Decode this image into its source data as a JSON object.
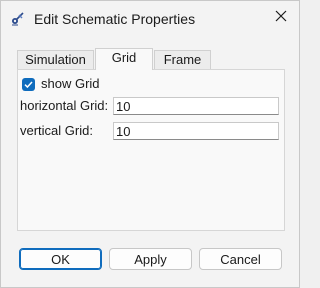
{
  "window": {
    "title": "Edit Schematic Properties",
    "app_icon": "schematic-app-icon",
    "close_icon": "close-icon"
  },
  "tabs": [
    {
      "label": "Simulation",
      "active": false
    },
    {
      "label": "Grid",
      "active": true
    },
    {
      "label": "Frame",
      "active": false
    }
  ],
  "grid": {
    "show_grid_label": "show Grid",
    "show_grid_checked": true,
    "horizontal_label": "horizontal Grid:",
    "horizontal_value": "10",
    "vertical_label": "vertical Grid:",
    "vertical_value": "10"
  },
  "buttons": {
    "ok": "OK",
    "apply": "Apply",
    "cancel": "Cancel"
  },
  "colors": {
    "accent": "#0f6cbd"
  }
}
